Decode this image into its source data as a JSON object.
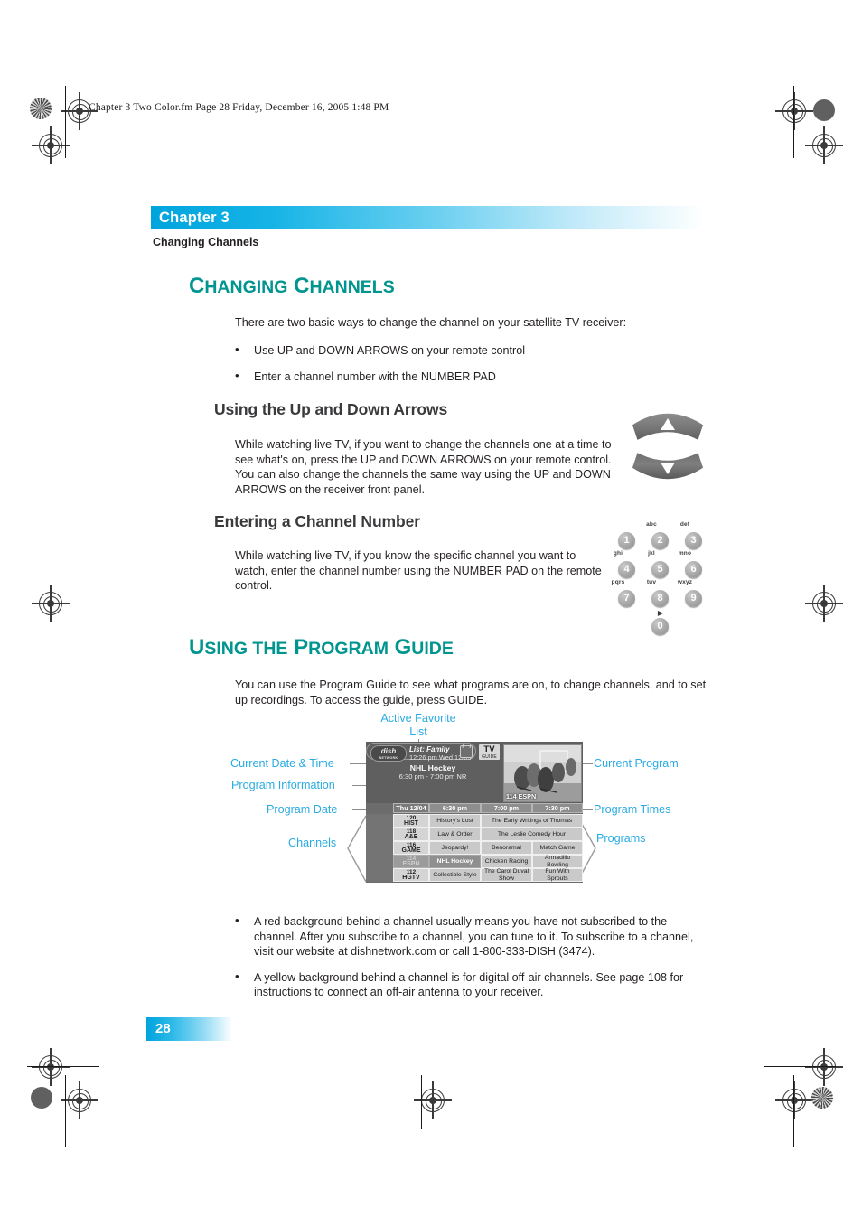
{
  "file_header": "Chapter 3 Two Color.fm  Page 28  Friday, December 16, 2005  1:48 PM",
  "chapter": {
    "banner_label": "Chapter 3",
    "subtitle": "Changing Channels"
  },
  "colors": {
    "accent_cyan": "#29abe2",
    "banner_cyan": "#00a4dd",
    "heading_teal": "#00968f",
    "subhead_gray": "#3a3a3c"
  },
  "sections": {
    "changing_channels": {
      "title_cap1": "C",
      "title_rest1": "HANGING",
      "title_cap2": "C",
      "title_rest2": "HANNELS",
      "intro": "There are two basic ways to change the channel on your satellite TV receiver:",
      "bullets": [
        "Use UP and DOWN ARROWS on your remote control",
        "Enter a channel number with the NUMBER PAD"
      ]
    },
    "up_down_arrows": {
      "heading": "Using the Up and Down Arrows",
      "body": "While watching live TV, if you want to change the channels one at a time to see what's on, press the UP and DOWN ARROWS on your remote control. You can also change the channels the same way using the UP and DOWN ARROWS on the receiver front panel."
    },
    "entering_channel": {
      "heading": "Entering a Channel Number",
      "body": "While watching live TV, if you know the specific channel you want to watch, enter the channel number using the NUMBER PAD on the remote control."
    },
    "program_guide": {
      "title_cap1": "U",
      "title_rest1": "SING THE",
      "title_cap2": "P",
      "title_rest2": "ROGRAM",
      "title_cap3": "G",
      "title_rest3": "UIDE",
      "body": "You can use the Program Guide to see what programs are on, to change channels, and to set up recordings. To access the guide, press GUIDE.",
      "bullets": [
        "A red background behind a channel usually means you have not subscribed to the channel. After you subscribe to a channel, you can tune to it. To subscribe to a channel, visit our website at dishnetwork.com or call 1-800-333-DISH (3474).",
        "A yellow background behind a channel is for digital off-air channels. See page 108 for instructions to connect an off-air antenna to your receiver."
      ]
    }
  },
  "remote": {
    "arrows": {
      "up_label": "UP ARROW",
      "down_label": "DOWN ARROW"
    },
    "keypad": {
      "keys": [
        {
          "digit": "1",
          "letters": ""
        },
        {
          "digit": "2",
          "letters": "abc"
        },
        {
          "digit": "3",
          "letters": "def"
        },
        {
          "digit": "4",
          "letters": "ghi"
        },
        {
          "digit": "5",
          "letters": "jkl"
        },
        {
          "digit": "6",
          "letters": "mno"
        },
        {
          "digit": "7",
          "letters": "pqrs"
        },
        {
          "digit": "8",
          "letters": "tuv"
        },
        {
          "digit": "9",
          "letters": "wxyz"
        },
        {
          "digit": "0",
          "letters": ""
        }
      ],
      "zero_arrow": "▶"
    }
  },
  "figure": {
    "callouts": {
      "active_favorite_list_line1": "Active Favorite",
      "active_favorite_list_line2": "List",
      "current_date_time": "Current Date & Time",
      "program_information": "Program Information",
      "program_date": "Program Date",
      "channels": "Channels",
      "current_program": "Current Program",
      "program_times": "Program Times",
      "programs": "Programs"
    },
    "guide": {
      "logo_text": "dish",
      "logo_sub": "NETWORK",
      "list_label": "List: Family",
      "date_time": "12:26 pm Wed 12/03",
      "tvguide_main": "TV",
      "tvguide_sub": "GUIDE",
      "program_title": "NHL Hockey",
      "program_time": "6:30 pm - 7:00 pm NR",
      "video_channel": "114 ESPN",
      "date_cell": "Thu 12/04",
      "time_headers": [
        "6:30 pm",
        "7:00 pm",
        "7:30 pm"
      ],
      "rows": [
        {
          "channel_num": "120",
          "channel_name": "HIST",
          "selected": false,
          "programs": [
            {
              "title": "History's Lost",
              "span": 1,
              "arrow_left": true,
              "selected": false
            },
            {
              "title": "The Early Writings of Thomas",
              "span": 2,
              "selected": false
            }
          ]
        },
        {
          "channel_num": "118",
          "channel_name": "A&E",
          "selected": false,
          "programs": [
            {
              "title": "Law & Order",
              "span": 1,
              "arrow_left": true,
              "selected": false
            },
            {
              "title": "The Leslie Comedy Hour",
              "span": 2,
              "selected": false
            }
          ]
        },
        {
          "channel_num": "116",
          "channel_name": "GAME",
          "selected": false,
          "programs": [
            {
              "title": "Jeopardy!",
              "span": 1,
              "selected": false
            },
            {
              "title": "Benoramal",
              "span": 1,
              "selected": false
            },
            {
              "title": "Match Game",
              "span": 1,
              "arrow_right": true,
              "selected": false
            }
          ]
        },
        {
          "channel_num": "114",
          "channel_name": "ESPN",
          "selected": true,
          "programs": [
            {
              "title": "NHL Hockey",
              "span": 1,
              "selected": true
            },
            {
              "title": "Chicken Racing",
              "span": 1,
              "selected": false
            },
            {
              "title": "Armadillo Bowling",
              "span": 1,
              "selected": false
            }
          ]
        },
        {
          "channel_num": "112",
          "channel_name": "HGTV",
          "selected": false,
          "programs": [
            {
              "title": "Collectible Style",
              "span": 1,
              "selected": false
            },
            {
              "title": "The Carol Duval Show",
              "span": 1,
              "selected": false
            },
            {
              "title": "Fun With Sprouts",
              "span": 1,
              "selected": false
            }
          ]
        }
      ]
    }
  },
  "footer": {
    "page_number": "28"
  }
}
